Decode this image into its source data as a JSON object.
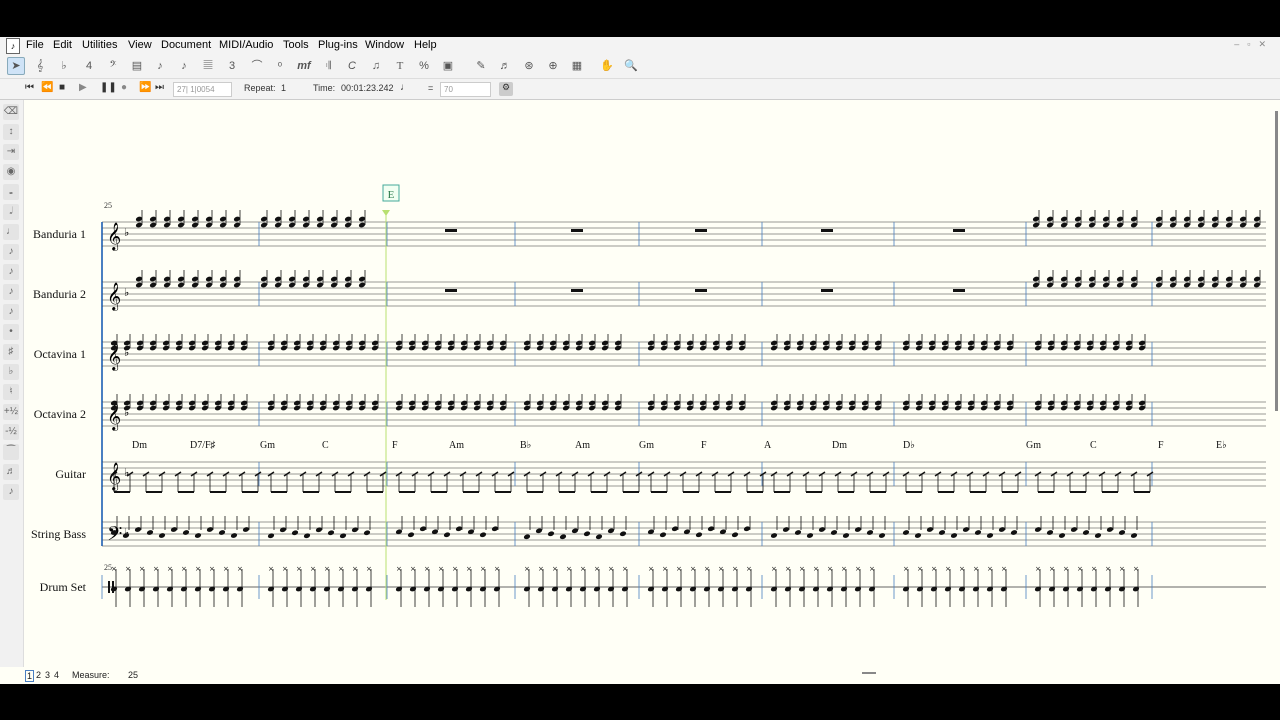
{
  "menubar": {
    "items": [
      "File",
      "Edit",
      "Utilities",
      "View",
      "Document",
      "MIDI/Audio",
      "Tools",
      "Plug-ins",
      "Window",
      "Help"
    ]
  },
  "toolbar": {
    "icons": [
      "selection-tool-icon",
      "staff-tool-icon",
      "key-signature-tool-icon",
      "time-signature-tool-icon",
      "clef-tool-icon",
      "measure-tool-icon",
      "simple-entry-icon",
      "speedy-entry-icon",
      "hyperscribe-icon",
      "tuplet-tool-icon",
      "smart-shape-icon",
      "articulation-tool-icon",
      "expression-tool-icon",
      "repeat-tool-icon",
      "chord-tool-icon",
      "lyrics-tool-icon",
      "text-tool-icon",
      "percent-tool-icon",
      "graphics-tool-icon",
      "special-tools-icon",
      "mirror-tool-icon",
      "note-mover-icon",
      "resize-tool-icon",
      "ossia-tool-icon",
      "hand-grabber-icon",
      "zoom-icon"
    ]
  },
  "playback": {
    "measure_beat": "27| 1|0054",
    "repeat_label": "Repeat:",
    "repeat_value": "1",
    "time_label": "Time:",
    "time_value": "00:01:23.242",
    "equals": "=",
    "tempo": "70"
  },
  "score": {
    "rehearsal_mark": "E",
    "first_measure_number": "25",
    "staves": [
      {
        "name": "Banduria 1"
      },
      {
        "name": "Banduria 2"
      },
      {
        "name": "Octavina 1"
      },
      {
        "name": "Octavina 2"
      },
      {
        "name": "Guitar"
      },
      {
        "name": "String Bass"
      },
      {
        "name": "Drum Set"
      }
    ],
    "chords": [
      "Dm",
      "D7/F♯",
      "Gm",
      "C",
      "F",
      "Am",
      "B♭",
      "Am",
      "Gm",
      "F",
      "A",
      "Dm",
      "D♭",
      "Gm",
      "C",
      "F",
      "E♭"
    ]
  },
  "status": {
    "pages": [
      "1",
      "2",
      "3",
      "4"
    ],
    "measure_label": "Measure:",
    "measure_value": "25"
  }
}
